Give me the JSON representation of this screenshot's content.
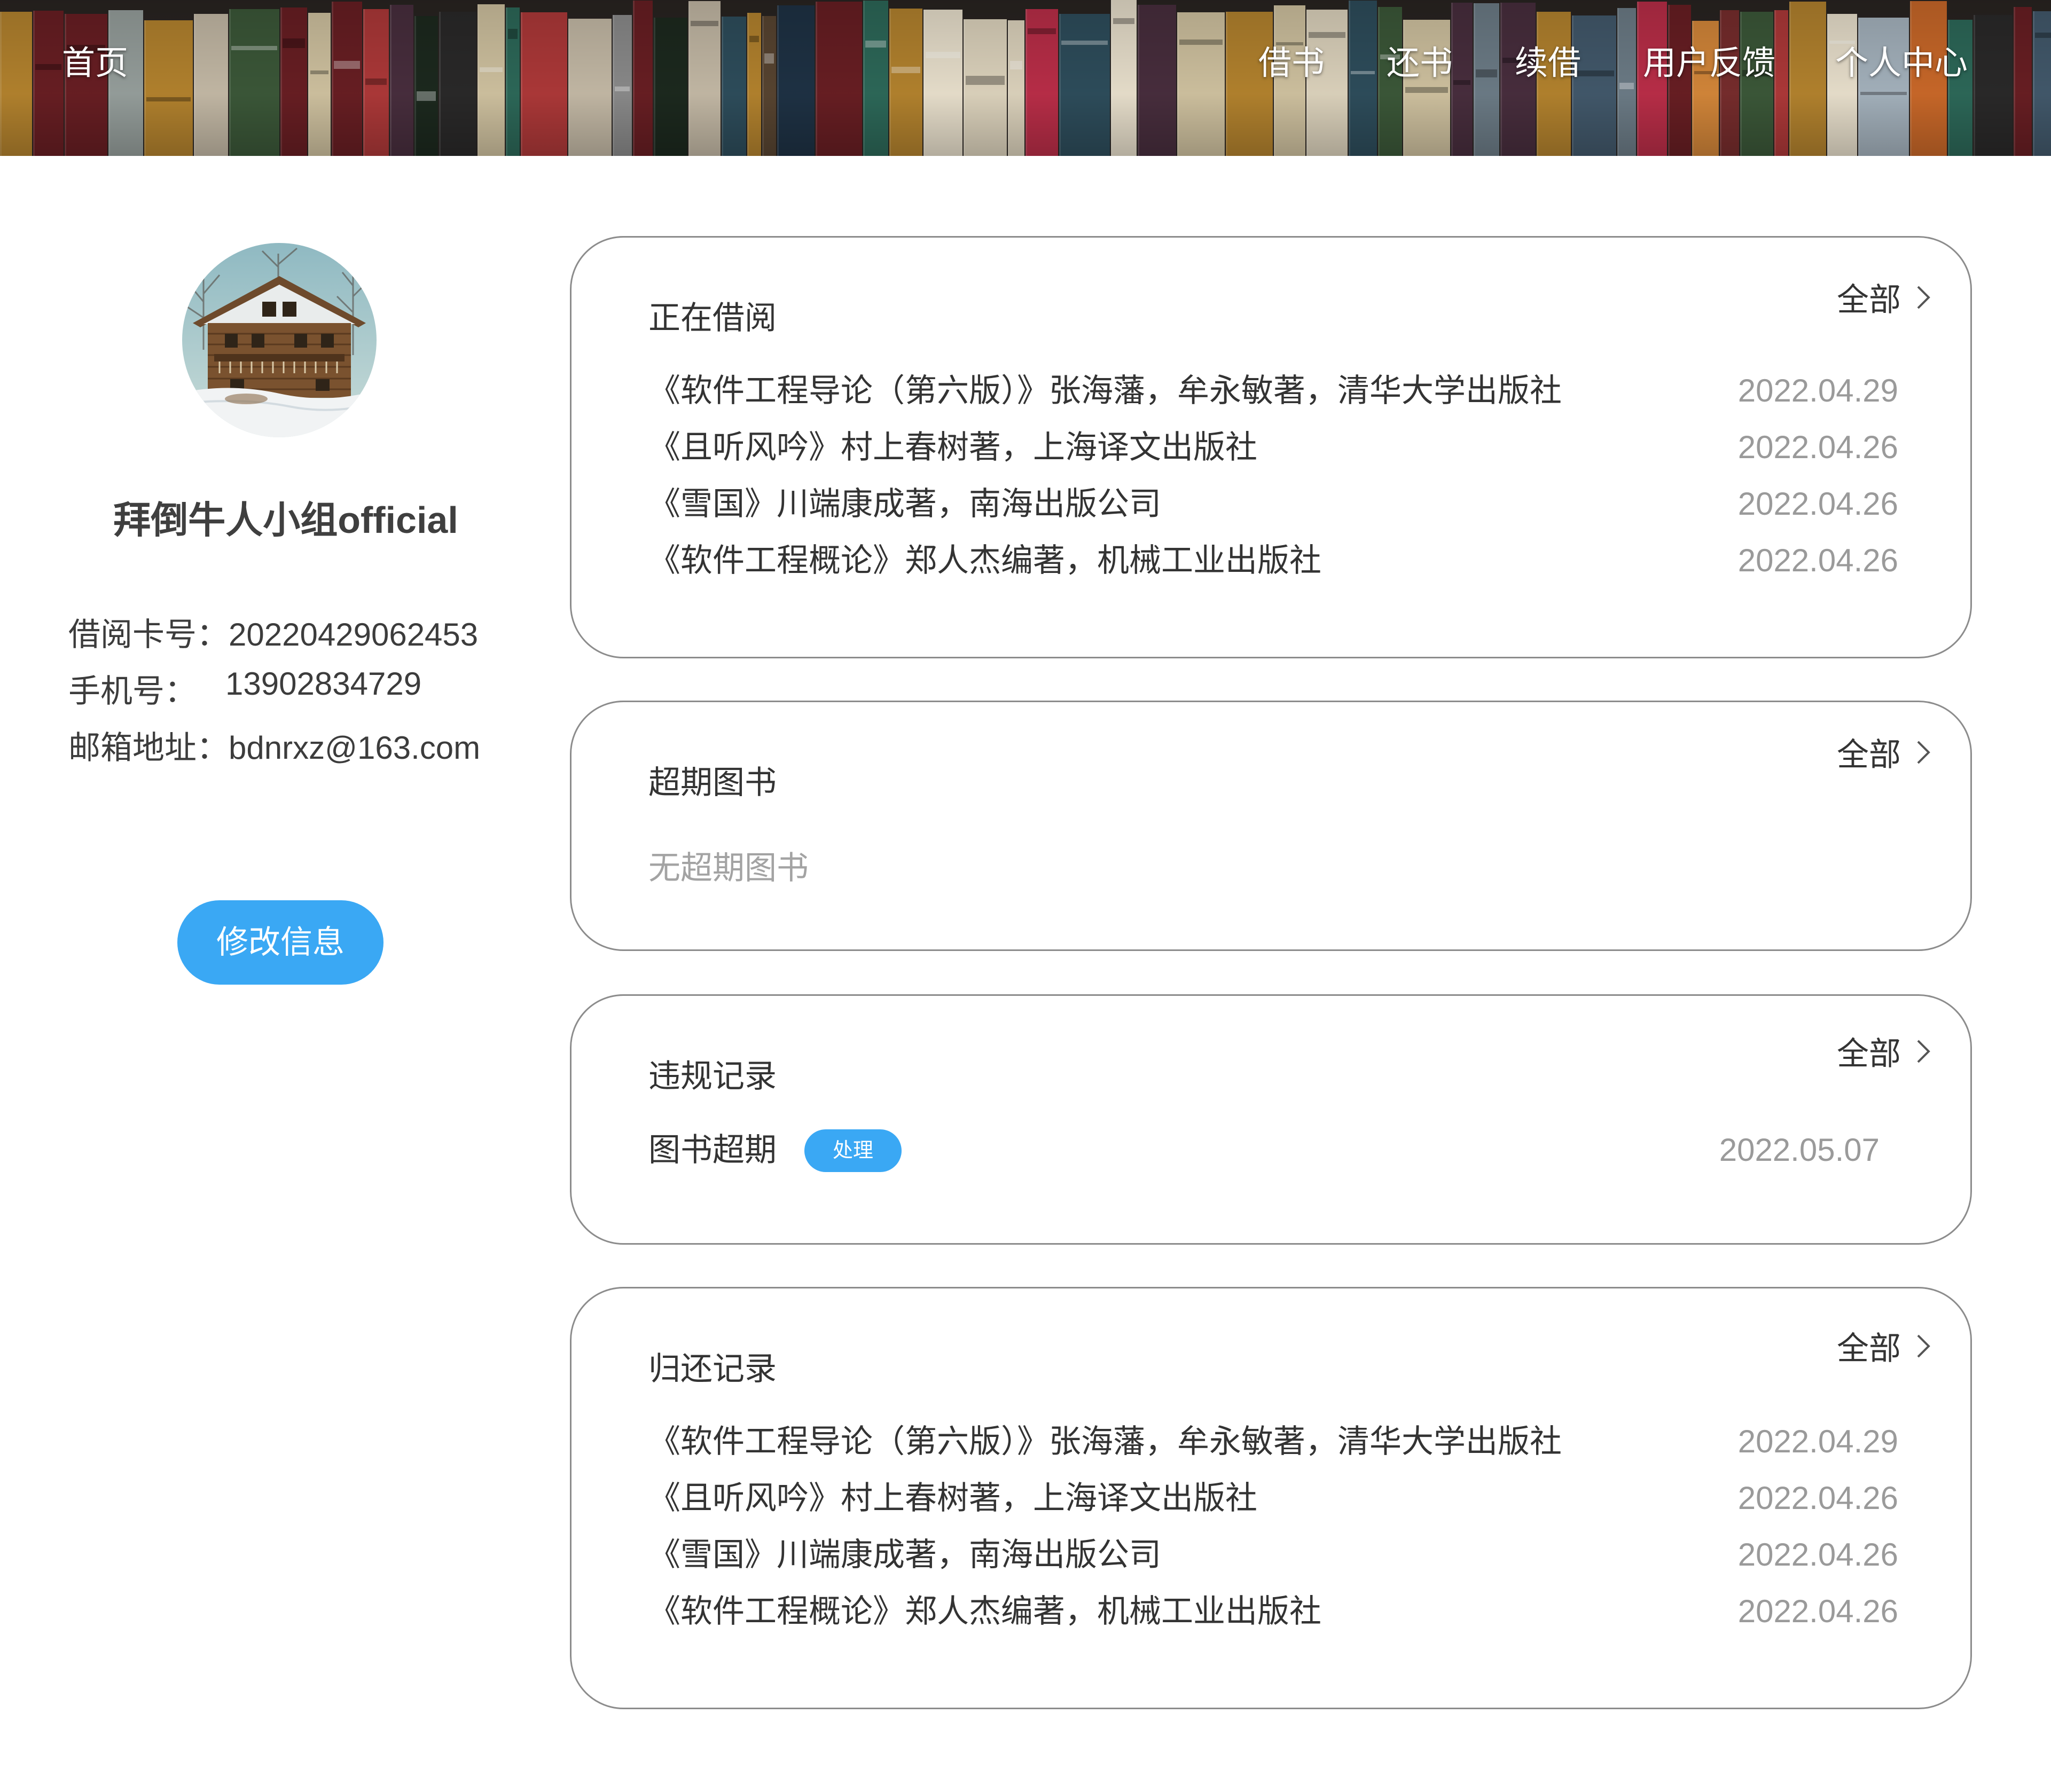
{
  "nav": {
    "home": "首页",
    "borrow": "借书",
    "return": "还书",
    "renew": "续借",
    "feedback": "用户反馈",
    "profile": "个人中心"
  },
  "user": {
    "name": "拜倒牛人小组official",
    "card_label": "借阅卡号：",
    "card_no": "20220429062453",
    "phone_label": "手机号：",
    "phone": "13902834729",
    "email_label": "邮箱地址：",
    "email": "bdnrxz@163.com",
    "edit_button": "修改信息"
  },
  "sections": {
    "all_label": "全部",
    "borrowing": {
      "title": "正在借阅",
      "items": [
        {
          "title": "《软件工程导论（第六版）》张海藩，牟永敏著，清华大学出版社",
          "date": "2022.04.29"
        },
        {
          "title": "《且听风吟》村上春树著，上海译文出版社",
          "date": "2022.04.26"
        },
        {
          "title": "《雪国》川端康成著，南海出版公司",
          "date": "2022.04.26"
        },
        {
          "title": "《软件工程概论》郑人杰编著，机械工业出版社",
          "date": "2022.04.26"
        }
      ]
    },
    "overdue": {
      "title": "超期图书",
      "empty_text": "无超期图书"
    },
    "violation": {
      "title": "违规记录",
      "items": [
        {
          "type": "图书超期",
          "action": "处理",
          "date": "2022.05.07"
        }
      ]
    },
    "returned": {
      "title": "归还记录",
      "items": [
        {
          "title": "《软件工程导论（第六版）》张海藩，牟永敏著，清华大学出版社",
          "date": "2022.04.29"
        },
        {
          "title": "《且听风吟》村上春树著，上海译文出版社",
          "date": "2022.04.26"
        },
        {
          "title": "《雪国》川端康成著，南海出版公司",
          "date": "2022.04.26"
        },
        {
          "title": "《软件工程概论》郑人杰编著，机械工业出版社",
          "date": "2022.04.26"
        }
      ]
    }
  },
  "colors": {
    "accent": "#3aa8f4",
    "card_border": "#8c8c8c",
    "muted_text": "#9a9a9a"
  },
  "icons": {
    "more": "chevron-right-icon",
    "avatar": "wooden-house-avatar"
  }
}
